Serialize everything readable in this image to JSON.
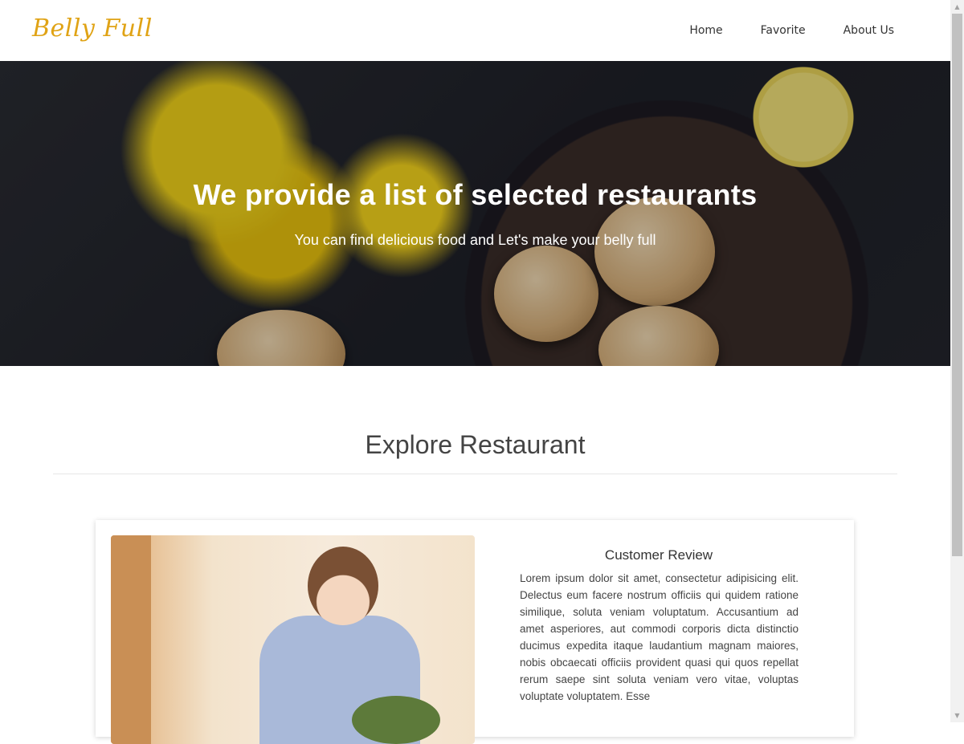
{
  "header": {
    "logo": "Belly Full",
    "nav": [
      {
        "label": "Home"
      },
      {
        "label": "Favorite"
      },
      {
        "label": "About Us"
      }
    ]
  },
  "hero": {
    "title": "We provide a list of selected restaurants",
    "subtitle": "You can find delicious food and Let's make your belly full"
  },
  "explore": {
    "title": "Explore Restaurant"
  },
  "review_card": {
    "title": "Customer Review",
    "text": "Lorem ipsum dolor sit amet, consectetur adipisicing elit. Delectus eum facere nostrum officiis qui quidem ratione similique, soluta veniam voluptatum. Accusantium ad amet asperiores, aut commodi corporis dicta distinctio ducimus expedita itaque laudantium magnam maiores, nobis obcaecati officiis provident quasi qui quos repellat rerum saepe sint soluta veniam vero vitae, voluptas voluptate voluptatem. Esse"
  },
  "colors": {
    "brand": "#e0a315",
    "text": "#333333",
    "divider": "#e6e6e6"
  }
}
